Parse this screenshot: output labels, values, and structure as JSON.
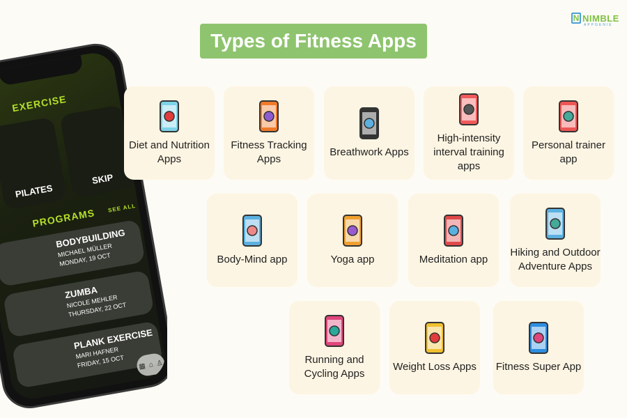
{
  "title": "Types of Fitness Apps",
  "logo": {
    "name": "NIMBLE",
    "sub": "APPGENIE"
  },
  "phone": {
    "section_exercise": "EXERCISE",
    "exercises": [
      "PILATES",
      "SKIP"
    ],
    "section_programs": "PROGRAMS",
    "see_all": "SEE ALL",
    "programs": [
      {
        "name": "BODYBUILDING",
        "trainer": "MICHAEL MÜLLER",
        "date": "MONDAY, 19 OCT"
      },
      {
        "name": "ZUMBA",
        "trainer": "NICOLE MEHLER",
        "date": "THURSDAY, 22 OCT"
      },
      {
        "name": "PLANK EXERCISE",
        "trainer": "MARI HAFNER",
        "date": "FRIDAY, 15 OCT"
      }
    ]
  },
  "cards": [
    {
      "label": "Diet and Nutrition Apps",
      "icon": "apple-phone-icon"
    },
    {
      "label": "Fitness Tracking Apps",
      "icon": "map-tracking-icon"
    },
    {
      "label": "Breathwork Apps",
      "icon": "phone-wind-icon"
    },
    {
      "label": "High-intensity interval training apps",
      "icon": "dumbbell-phone-icon"
    },
    {
      "label": "Personal trainer app",
      "icon": "trainer-watch-icon"
    },
    {
      "label": "Body-Mind app",
      "icon": "brain-phone-icon"
    },
    {
      "label": "Yoga app",
      "icon": "yoga-phone-icon"
    },
    {
      "label": "Meditation app",
      "icon": "meditation-phone-icon"
    },
    {
      "label": "Hiking and Outdoor Adventure Apps",
      "icon": "smartwatch-hand-icon"
    },
    {
      "label": "Running and Cycling Apps",
      "icon": "cycling-phone-icon"
    },
    {
      "label": "Weight Loss Apps",
      "icon": "apple-scale-icon"
    },
    {
      "label": "Fitness Super App",
      "icon": "runner-phone-icon"
    }
  ],
  "colors": {
    "title_bg": "#8fc46f",
    "card_bg": "#fdf5e3",
    "accent": "#b5e02a"
  }
}
